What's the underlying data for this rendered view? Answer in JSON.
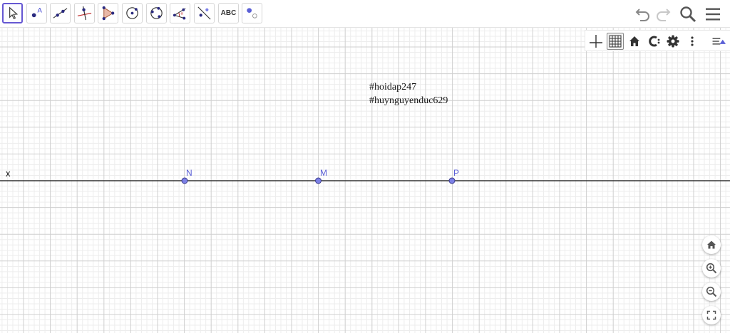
{
  "toolbar": {
    "tools": [
      {
        "name": "move",
        "tooltip": ""
      },
      {
        "name": "point",
        "icon_letter": "A"
      },
      {
        "name": "line"
      },
      {
        "name": "perpendicular-line"
      },
      {
        "name": "polygon"
      },
      {
        "name": "circle-center-point"
      },
      {
        "name": "circle-three-points"
      },
      {
        "name": "angle",
        "icon_letter": "α"
      },
      {
        "name": "reflect-about-line"
      },
      {
        "name": "text",
        "label": "ABC"
      },
      {
        "name": "slider"
      }
    ],
    "right_icons": [
      "undo-icon",
      "redo-icon",
      "search-icon",
      "menu-icon"
    ]
  },
  "style_bar": {
    "buttons": [
      "show-axes",
      "show-grid",
      "standard-view",
      "point-capturing",
      "settings",
      "more"
    ]
  },
  "canvas": {
    "annotations": [
      "#hoidap247",
      "#huynguyenduc629"
    ],
    "line_label": "x",
    "points": [
      {
        "label": "N"
      },
      {
        "label": "M"
      },
      {
        "label": "P"
      }
    ]
  },
  "zoom_panel": {
    "buttons": [
      "home-icon",
      "zoom-in-icon",
      "zoom-out-icon",
      "fullscreen-icon"
    ]
  },
  "colors": {
    "accent": "#6557d2",
    "point_fill": "#7c80e6",
    "point_label": "#5a5fd6",
    "grid_major": "#cfcfcf",
    "grid_minor": "#ededed",
    "line": "#333333"
  }
}
